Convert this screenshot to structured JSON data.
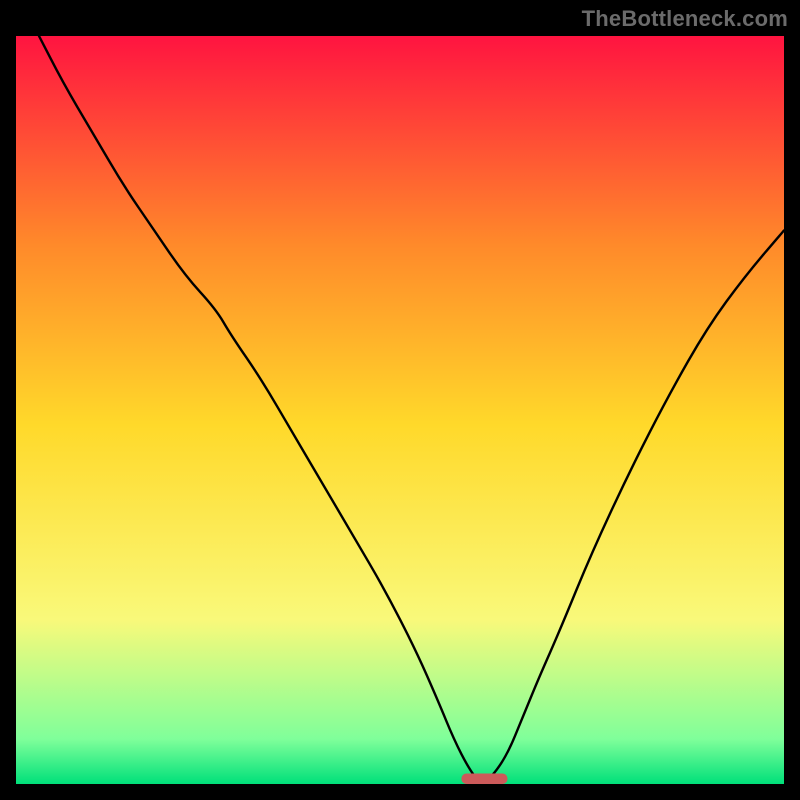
{
  "watermark": "TheBottleneck.com",
  "chart_data": {
    "type": "line",
    "title": "",
    "xlabel": "",
    "ylabel": "",
    "xlim": [
      0,
      100
    ],
    "ylim": [
      0,
      100
    ],
    "grid": false,
    "legend": false,
    "background_gradient": {
      "top": "#ff1440",
      "upper_mid": "#ff8a2a",
      "mid": "#ffd92a",
      "lower_mid": "#f9f97a",
      "near_bottom": "#7fff9a",
      "bottom": "#00e07a"
    },
    "marker": {
      "shape": "rounded-bar",
      "color": "#cc5a5a",
      "position_x": 61,
      "position_y": 0,
      "width": 6,
      "height": 1.4
    },
    "series": [
      {
        "name": "curve",
        "color": "#000000",
        "x": [
          3,
          6,
          10,
          14,
          18,
          22,
          26,
          28,
          32,
          36,
          40,
          44,
          48,
          52,
          55,
          57,
          59,
          60.5,
          62,
          64,
          66,
          68,
          71,
          75,
          80,
          85,
          90,
          95,
          100
        ],
        "y": [
          100,
          94,
          87,
          80,
          74,
          68,
          63.5,
          60,
          54,
          47,
          40,
          33,
          26,
          18,
          11,
          6,
          2,
          0,
          1,
          4,
          9,
          14,
          21,
          31,
          42,
          52,
          61,
          68,
          74
        ]
      }
    ]
  }
}
